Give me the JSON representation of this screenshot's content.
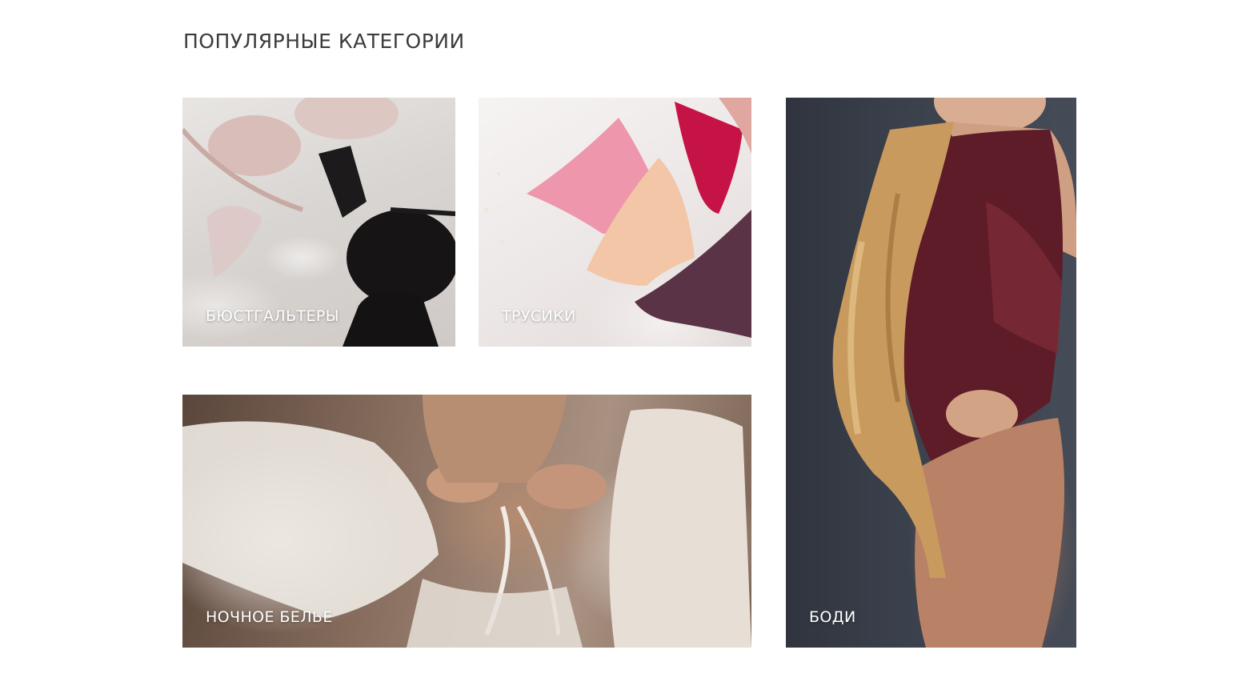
{
  "page": {
    "title": "ПОПУЛЯРНЫЕ КАТЕГОРИИ"
  },
  "categories": [
    {
      "label": "БЮСТГАЛЬТЕРЫ"
    },
    {
      "label": "ТРУСИКИ"
    },
    {
      "label": "НОЧНОЕ БЕЛЬЕ"
    },
    {
      "label": "БОДИ"
    }
  ],
  "colors": {
    "heading_text": "#3c3c3c",
    "label_text": "#ffffff",
    "background": "#ffffff"
  }
}
